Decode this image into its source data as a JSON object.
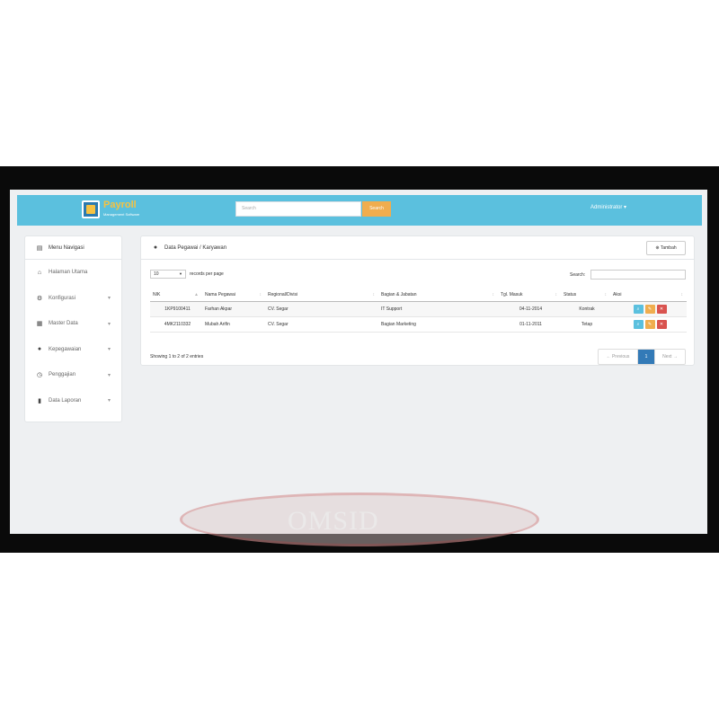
{
  "navbar": {
    "logo_title": "Payroll",
    "logo_subtitle": "Management Software",
    "search_placeholder": "Search",
    "search_button": "Search",
    "user_menu": "Administrator ▾"
  },
  "sidebar": {
    "title": "Menu Navigasi",
    "items": [
      {
        "label": "Halaman Utama",
        "icon": "home-icon",
        "has_submenu": false
      },
      {
        "label": "Konfigurasi",
        "icon": "gear-icon",
        "has_submenu": true
      },
      {
        "label": "Master Data",
        "icon": "building-icon",
        "has_submenu": true
      },
      {
        "label": "Kepegawaian",
        "icon": "user-icon",
        "has_submenu": true
      },
      {
        "label": "Penggajian",
        "icon": "clock-icon",
        "has_submenu": true
      },
      {
        "label": "Data Laporan",
        "icon": "file-icon",
        "has_submenu": true
      }
    ]
  },
  "panel": {
    "title": "Data Pegawai / Karyawan",
    "add_button": "Tambah",
    "records_per_page_value": "10",
    "records_per_page_label": "records per page",
    "search_label": "Search:",
    "columns": [
      "NIK",
      "Nama Pegawai",
      "Regional/Divisi",
      "Bagian & Jabatan",
      "Tgl. Masuk",
      "Status",
      "Aksi"
    ],
    "rows": [
      [
        "1KP9100411",
        "Farhan Akpar",
        "CV. Segar",
        "IT Support",
        "04-11-2014",
        "Kontrak"
      ],
      [
        "4MK2110332",
        "Mubah Arifin",
        "CV. Segar",
        "Bagian Marketing",
        "01-11-2011",
        "Tetap"
      ]
    ],
    "info": "Showing 1 to 2 of 2 entries",
    "pager": {
      "prev": "← Previous",
      "current": "1",
      "next": "Next →"
    }
  },
  "watermark": "OMSID",
  "colors": {
    "navbar": "#5bc0de",
    "search_button": "#f0ad4e",
    "view": "#5bc0de",
    "edit": "#f0ad4e",
    "delete": "#d9534f",
    "pager_active": "#337ab7"
  }
}
